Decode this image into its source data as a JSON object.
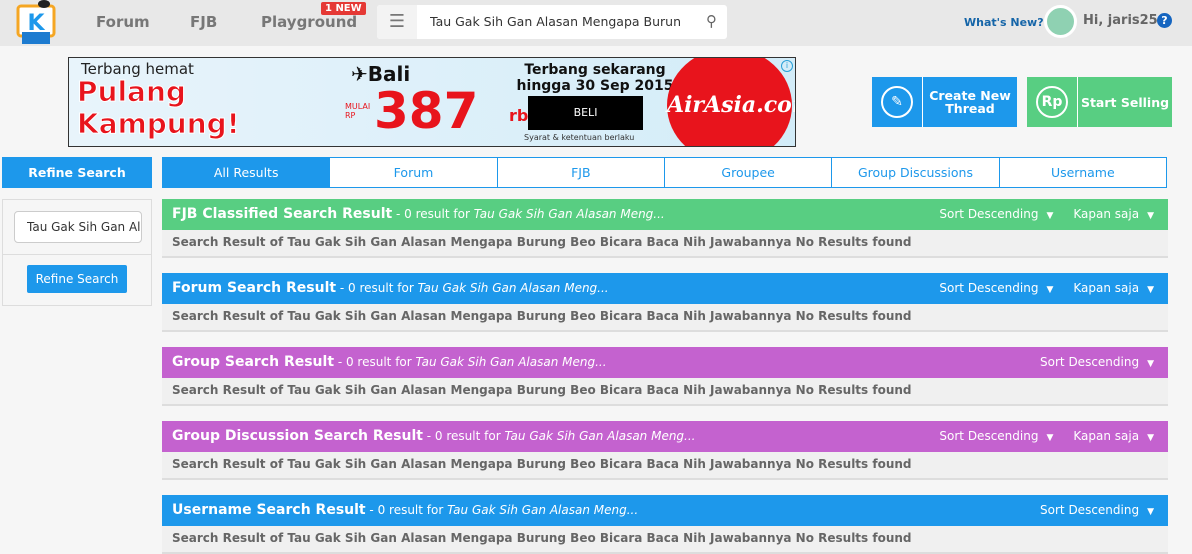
{
  "header": {
    "nav": [
      "Forum",
      "FJB",
      "Playground"
    ],
    "badge": "1 NEW",
    "search_value": "Tau Gak Sih Gan Alasan Mengapa Burung Beo Bicara Baca Nih Jawabannya",
    "whats_new": "What's New?",
    "greeting": "Hi, jaris25",
    "help": "?"
  },
  "ad": {
    "line1": "Terbang hemat",
    "headline1": "Pulang",
    "headline2": "Kampung!",
    "dest": "✈Bali",
    "mulai": "MULAI",
    "rp": "RP",
    "price": "387",
    "unit": "rb",
    "cta_text": "Terbang sekarang hingga 30 Sep 2015",
    "beli": "BELI",
    "terms": "Syarat & ketentuan berlaku",
    "brand": "AirAsia.com",
    "info": "i"
  },
  "actions": {
    "create": "Create New Thread",
    "sell": "Start Selling",
    "rp": "Rp"
  },
  "sidebar": {
    "title": "Refine Search",
    "input_value": "Tau Gak Sih Gan Alasan Mengapa Burung Beo Bicara Baca Nih Jawabannya",
    "button": "Refine Search"
  },
  "tabs": [
    "All Results",
    "Forum",
    "FJB",
    "Groupee",
    "Group Discussions",
    "Username"
  ],
  "colors": {
    "blue": "#1d98eb",
    "green": "#58ce82",
    "purple": "#c462cf"
  },
  "sections": [
    {
      "title": "FJB Classified Search Result",
      "count": " - 0 result for ",
      "query": "Tau Gak Sih Gan Alasan Meng...",
      "sort": "Sort Descending",
      "time": "Kapan saja",
      "body": "Search Result of Tau Gak Sih Gan Alasan Mengapa Burung Beo Bicara Baca Nih Jawabannya No Results found"
    },
    {
      "title": "Forum Search Result",
      "count": " - 0 result for ",
      "query": "Tau Gak Sih Gan Alasan Meng...",
      "sort": "Sort Descending",
      "time": "Kapan saja",
      "body": "Search Result of Tau Gak Sih Gan Alasan Mengapa Burung Beo Bicara Baca Nih Jawabannya No Results found"
    },
    {
      "title": "Group Search Result",
      "count": " - 0 result for ",
      "query": "Tau Gak Sih Gan Alasan Meng...",
      "sort": "Sort Descending",
      "body": "Search Result of Tau Gak Sih Gan Alasan Mengapa Burung Beo Bicara Baca Nih Jawabannya No Results found"
    },
    {
      "title": "Group Discussion Search Result",
      "count": " - 0 result for ",
      "query": "Tau Gak Sih Gan Alasan Meng...",
      "sort": "Sort Descending",
      "time": "Kapan saja",
      "body": "Search Result of Tau Gak Sih Gan Alasan Mengapa Burung Beo Bicara Baca Nih Jawabannya No Results found"
    },
    {
      "title": "Username Search Result",
      "count": " - 0 result for ",
      "query": "Tau Gak Sih Gan Alasan Meng...",
      "sort": "Sort Descending",
      "body": "Search Result of Tau Gak Sih Gan Alasan Mengapa Burung Beo Bicara Baca Nih Jawabannya No Results found"
    }
  ]
}
